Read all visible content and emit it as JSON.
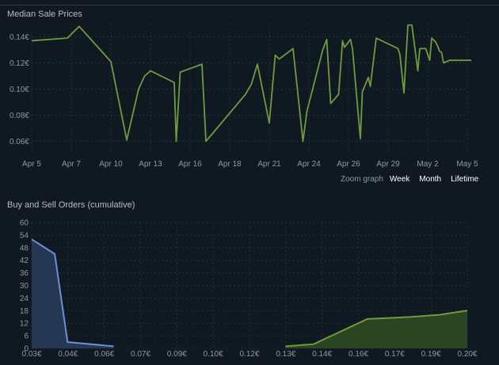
{
  "median": {
    "title": "Median Sale Prices",
    "zoom_label": "Zoom graph",
    "zoom_options": [
      "Week",
      "Month",
      "Lifetime"
    ]
  },
  "orders": {
    "title": "Buy and Sell Orders (cumulative)"
  },
  "colors": {
    "background": "#101822",
    "grid": "#243040",
    "axis_text": "#8f98a0",
    "price_line": "#6f9b3f",
    "buy_line": "#6c8fd1",
    "buy_fill": "#2a3d5c",
    "sell_line": "#6f9b3f",
    "sell_fill": "#2f4a22"
  },
  "chart_data": [
    {
      "type": "line",
      "title": "Median Sale Prices",
      "x_ticks": [
        "Apr 5",
        "Apr 7",
        "Apr 10",
        "Apr 13",
        "Apr 16",
        "Apr 18",
        "Apr 21",
        "Apr 24",
        "Apr 26",
        "Apr 29",
        "May 2",
        "May 5"
      ],
      "y_ticks": [
        "0.06€",
        "0.08€",
        "0.10€",
        "0.12€",
        "0.14€"
      ],
      "ylim": [
        0.05,
        0.15
      ],
      "grid": true,
      "series": [
        {
          "x": [
            0,
            0.9,
            1.2,
            2.0,
            2.4,
            2.7,
            2.85,
            3.0,
            3.6,
            3.65,
            3.75,
            4.3,
            4.4,
            5.4,
            5.55,
            5.7,
            6.0,
            6.15,
            6.25,
            6.6,
            6.85,
            6.95,
            7.35,
            7.45,
            7.55,
            7.75,
            7.85,
            7.9,
            8.0,
            8.05,
            8.1,
            8.3,
            8.35,
            8.5,
            8.55,
            8.7,
            9.25,
            9.3,
            9.4,
            9.5,
            9.6,
            9.75,
            9.8,
            9.95,
            10.05,
            10.1,
            10.2,
            10.25,
            10.3,
            10.35,
            10.4,
            10.55,
            10.6,
            10.7,
            10.75,
            10.8,
            11.0,
            11.1
          ],
          "y": [
            0.137,
            0.139,
            0.148,
            0.121,
            0.061,
            0.1,
            0.11,
            0.114,
            0.105,
            0.06,
            0.113,
            0.119,
            0.06,
            0.096,
            0.104,
            0.119,
            0.074,
            0.126,
            0.123,
            0.131,
            0.06,
            0.083,
            0.13,
            0.138,
            0.089,
            0.096,
            0.137,
            0.132,
            0.136,
            0.138,
            0.131,
            0.062,
            0.098,
            0.109,
            0.102,
            0.139,
            0.131,
            0.126,
            0.097,
            0.149,
            0.149,
            0.114,
            0.131,
            0.131,
            0.122,
            0.139,
            0.136,
            0.133,
            0.129,
            0.128,
            0.12,
            0.122,
            0.122,
            0.122,
            0.122,
            0.122,
            0.122,
            0.122
          ]
        }
      ]
    },
    {
      "type": "area",
      "title": "Buy and Sell Orders (cumulative)",
      "x_ticks": [
        "0.03€",
        "0.04€",
        "0.06€",
        "0.07€",
        "0.09€",
        "0.10€",
        "0.12€",
        "0.13€",
        "0.14€",
        "0.16€",
        "0.17€",
        "0.19€",
        "0.20€"
      ],
      "y_ticks": [
        0,
        6,
        12,
        18,
        24,
        30,
        36,
        42,
        48,
        54,
        60
      ],
      "xlim": [
        0.03,
        0.2
      ],
      "ylim": [
        0,
        60
      ],
      "grid": true,
      "series": [
        {
          "role": "buy",
          "x": [
            0.03,
            0.039,
            0.044,
            0.062
          ],
          "y": [
            52,
            45,
            3,
            1
          ]
        },
        {
          "role": "sell",
          "x": [
            0.129,
            0.14,
            0.161,
            0.178,
            0.189,
            0.2
          ],
          "y": [
            1,
            2,
            14,
            15,
            16,
            18
          ]
        }
      ]
    }
  ]
}
